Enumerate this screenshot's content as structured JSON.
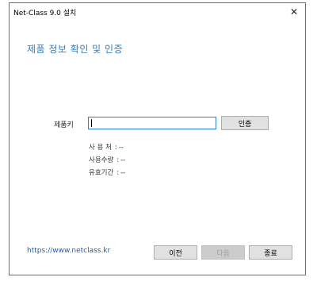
{
  "window": {
    "title": "Net-Class 9.0 설치",
    "close_glyph": "✕"
  },
  "main": {
    "heading": "제품 정보 확인 및 인증",
    "product_key_label": "제품키",
    "product_key_value": "",
    "auth_button": "인증",
    "info": [
      {
        "label": "사 용 처",
        "value": "--"
      },
      {
        "label": "사용수량",
        "value": "--"
      },
      {
        "label": "유효기간",
        "value": "--"
      }
    ]
  },
  "footer": {
    "link": "https://www.netclass.kr",
    "prev_button": "이전",
    "next_button": "다음",
    "exit_button": "종료"
  }
}
